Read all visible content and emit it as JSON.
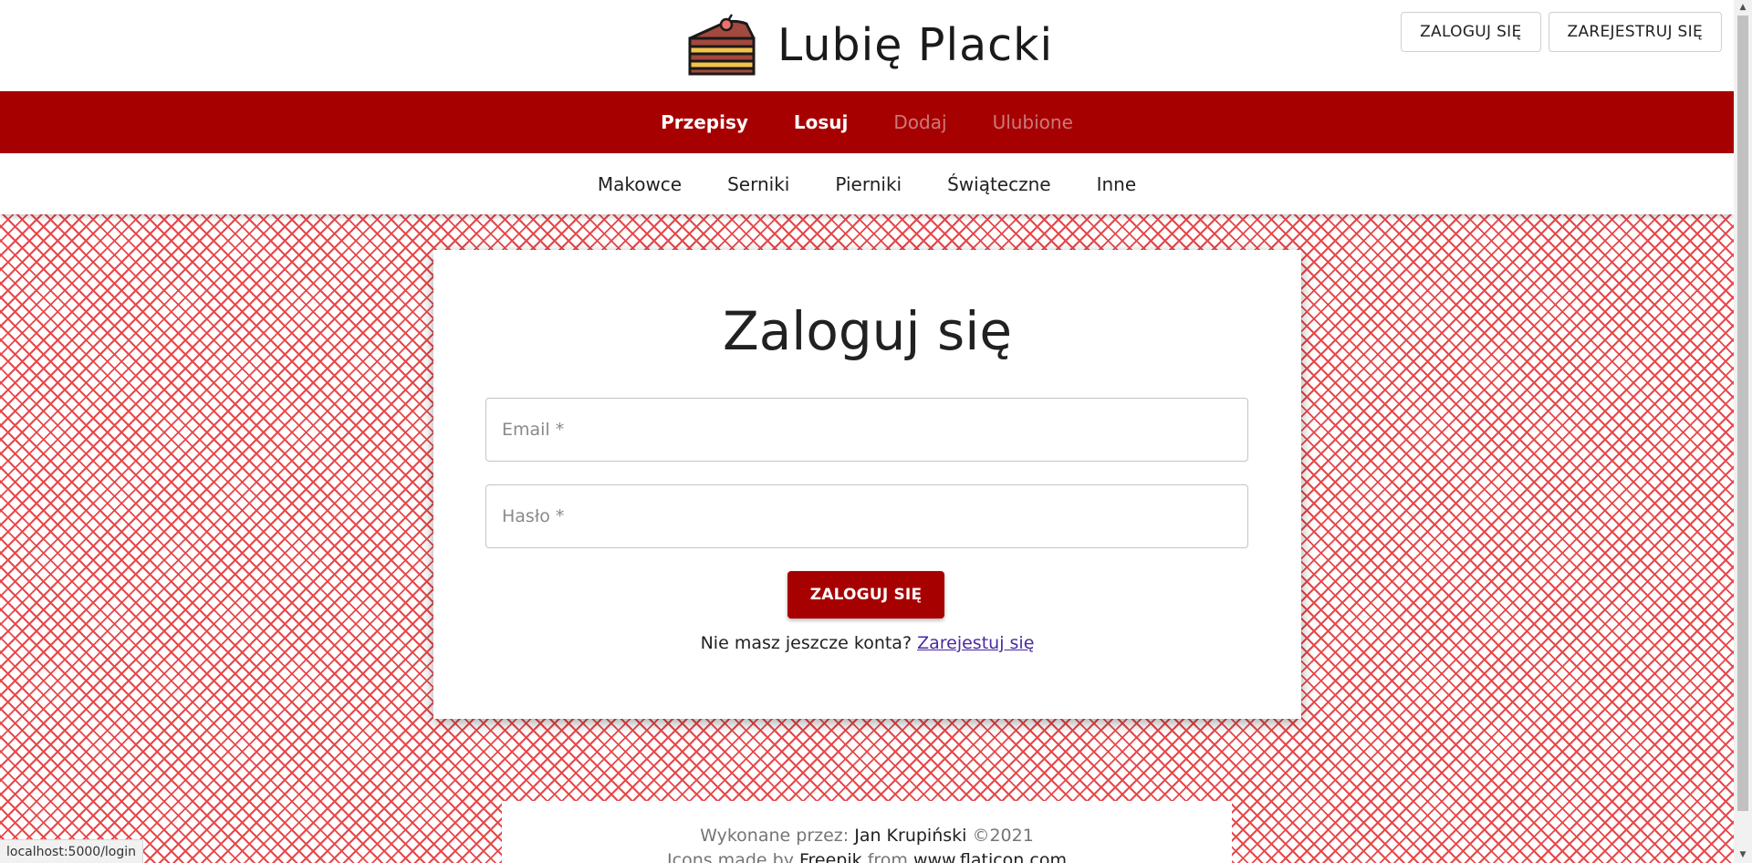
{
  "brand": {
    "name": "Lubię Placki",
    "logo_icon": "cake-slice-icon"
  },
  "auth": {
    "login_label": "ZALOGUJ SIĘ",
    "register_label": "ZAREJESTRUJ SIĘ"
  },
  "main_nav": {
    "items": [
      {
        "label": "Przepisy",
        "active": true
      },
      {
        "label": "Losuj",
        "active": true
      },
      {
        "label": "Dodaj",
        "active": false
      },
      {
        "label": "Ulubione",
        "active": false
      }
    ]
  },
  "category_nav": {
    "items": [
      "Makowce",
      "Serniki",
      "Pierniki",
      "Świąteczne",
      "Inne"
    ]
  },
  "login_form": {
    "title": "Zaloguj się",
    "email_placeholder": "Email *",
    "password_placeholder": "Hasło *",
    "submit_label": "ZALOGUJ SIĘ",
    "no_account_text": "Nie masz jeszcze konta?",
    "register_link": "Zarejestuj się"
  },
  "footer": {
    "made_by_prefix": "Wykonane przez:",
    "author": "Jan Krupiński",
    "year": "©2021",
    "icons_prefix": "Icons made by",
    "icons_author": "Freepik",
    "icons_from": "from",
    "icons_site": "www.flaticon.com"
  },
  "status_bar": {
    "url": "localhost:5000/login"
  },
  "colors": {
    "brand_red": "#a70000",
    "pattern_red": "#e8484b",
    "link_purple": "#4a2aa0"
  }
}
